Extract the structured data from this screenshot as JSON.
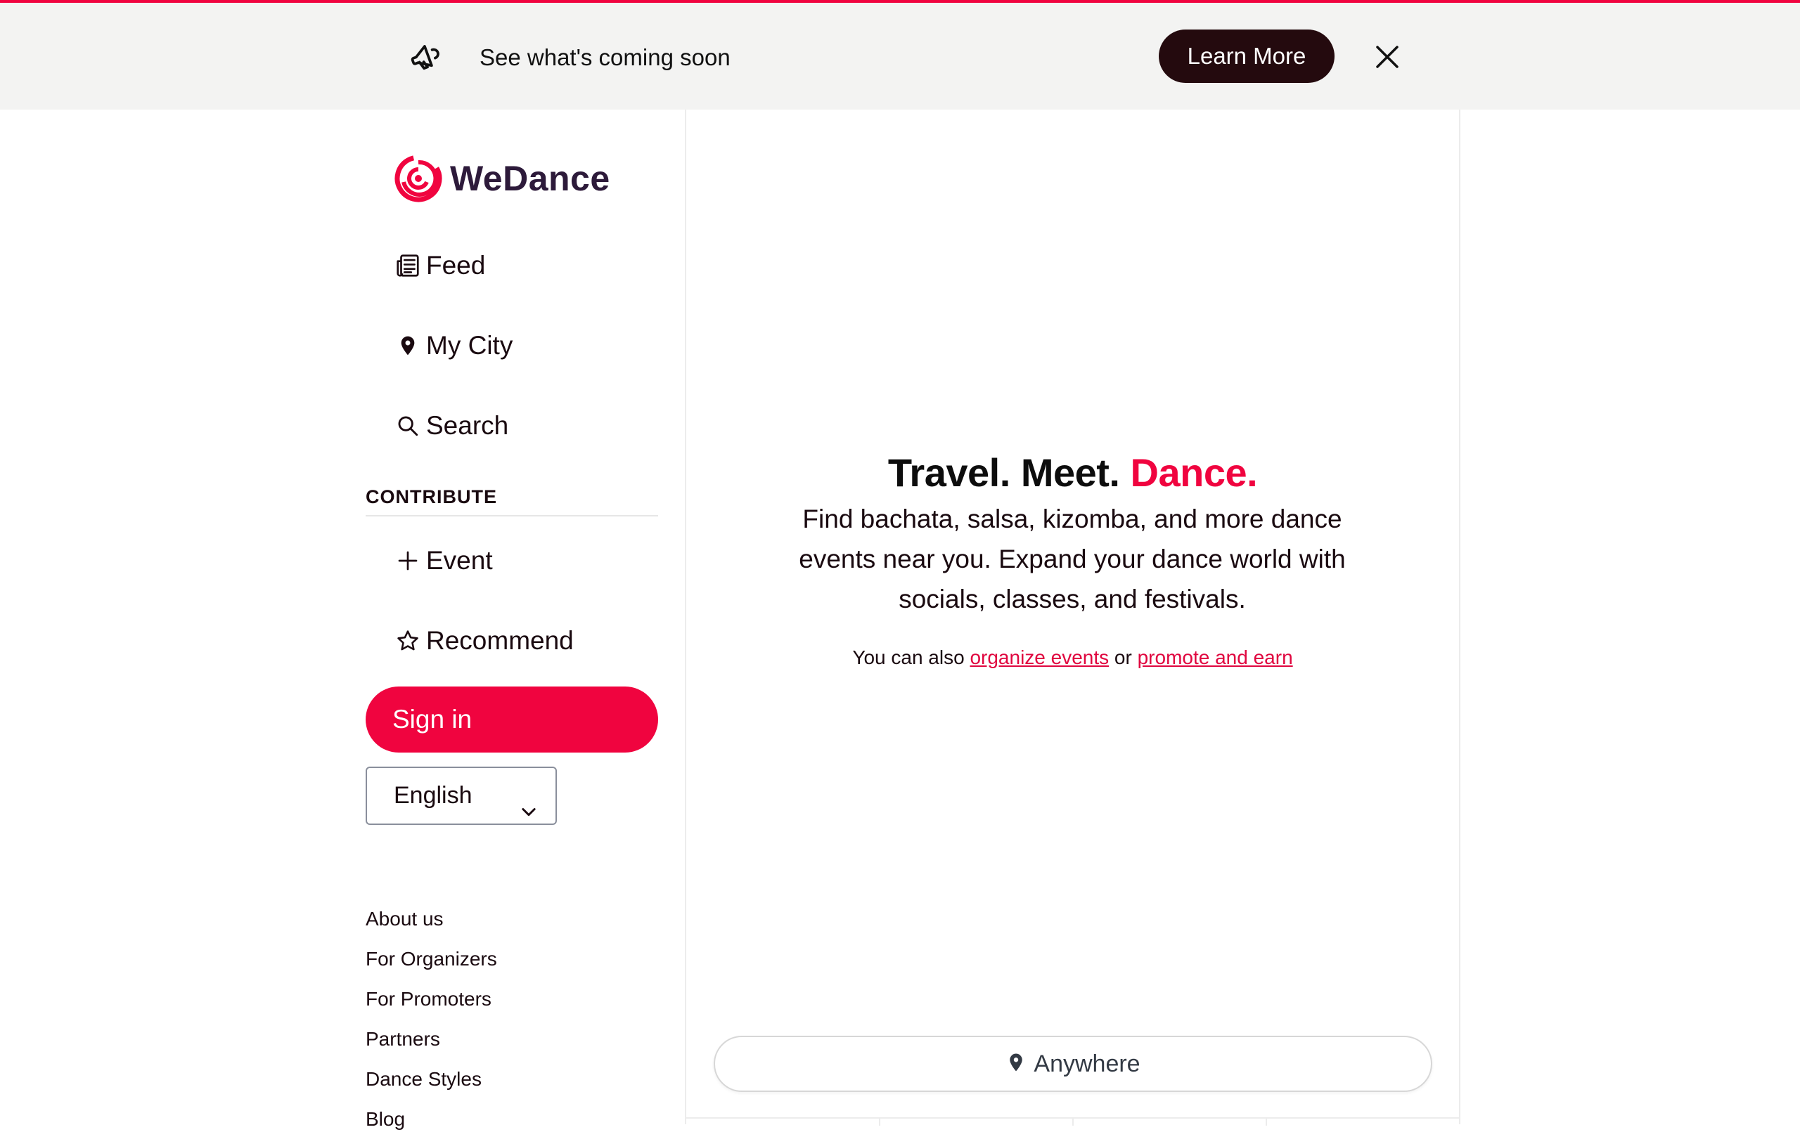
{
  "banner": {
    "text": "See what's coming soon",
    "learn_more": "Learn More",
    "icon": "megaphone-icon",
    "close_icon": "close-icon"
  },
  "brand": {
    "name": "WeDance",
    "accent_color": "#f0043f",
    "dark_color": "#240a0e"
  },
  "nav": {
    "items": [
      {
        "label": "Feed",
        "icon": "newspaper-icon"
      },
      {
        "label": "My City",
        "icon": "location-pin-icon"
      },
      {
        "label": "Search",
        "icon": "search-icon"
      }
    ],
    "contribute_heading": "CONTRIBUTE",
    "contribute_items": [
      {
        "label": "Event",
        "icon": "plus-icon"
      },
      {
        "label": "Recommend",
        "icon": "star-icon"
      }
    ],
    "sign_in": "Sign in",
    "language": "English"
  },
  "footer_links": [
    "About us",
    "For Organizers",
    "For Promoters",
    "Partners",
    "Dance Styles",
    "Blog"
  ],
  "hero": {
    "title_part1": "Travel. Meet. ",
    "title_accent": "Dance.",
    "subtitle": "Find bachata, salsa, kizomba, and more dance events near you. Expand your dance world with socials, classes, and festivals.",
    "note_prefix": "You can also ",
    "link1": "organize events",
    "note_mid": " or ",
    "link2": "promote and earn"
  },
  "location_filter": {
    "label": "Anywhere",
    "icon": "location-pin-icon"
  }
}
